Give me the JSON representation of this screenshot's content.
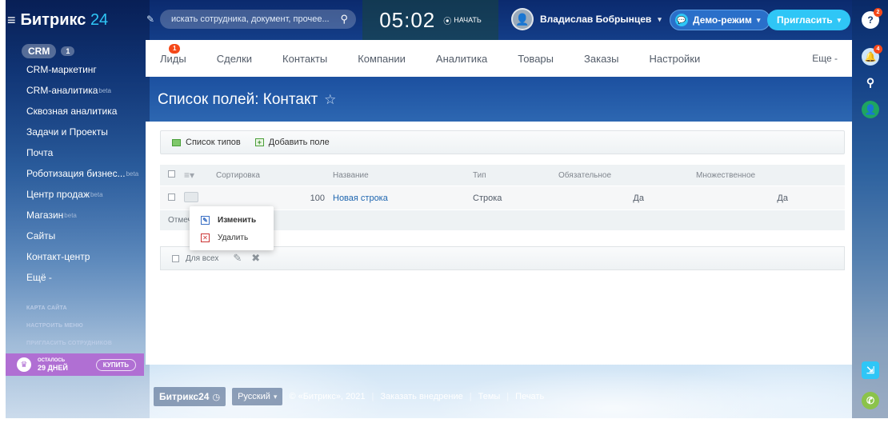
{
  "header": {
    "logo_main": "Битрикс",
    "logo_accent": "24",
    "search_placeholder": "искать сотрудника, документ, прочее...",
    "clock": "05:02",
    "start_label": "НАЧАТЬ",
    "user_name": "Владислав Бобрынцев",
    "demo_label": "Демо-режим",
    "invite_label": "Пригласить"
  },
  "rail": {
    "help_badge": "2",
    "notify_badge": "4"
  },
  "sidebar": {
    "crm_label": "CRM",
    "crm_count": "1",
    "items": [
      {
        "label": "CRM-маркетинг",
        "sup": ""
      },
      {
        "label": "CRM-аналитика",
        "sup": "beta"
      },
      {
        "label": "Сквозная аналитика",
        "sup": ""
      },
      {
        "label": "Задачи и Проекты",
        "sup": ""
      },
      {
        "label": "Почта",
        "sup": ""
      },
      {
        "label": "Роботизация бизнес...",
        "sup": "beta"
      },
      {
        "label": "Центр продаж",
        "sup": "beta"
      },
      {
        "label": "Магазин",
        "sup": "beta"
      },
      {
        "label": "Сайты",
        "sup": ""
      },
      {
        "label": "Контакт-центр",
        "sup": ""
      },
      {
        "label": "Ещё -",
        "sup": ""
      }
    ],
    "links": [
      "КАРТА САЙТА",
      "НАСТРОИТЬ МЕНЮ",
      "ПРИГЛАСИТЬ СОТРУДНИКОВ"
    ],
    "trial_small": "ОСТАЛОСЬ",
    "trial_days": "29 ДНЕЙ",
    "buy_label": "КУПИТЬ"
  },
  "tabs": {
    "items": [
      "Лиды",
      "Сделки",
      "Контакты",
      "Компании",
      "Аналитика",
      "Товары",
      "Заказы",
      "Настройки"
    ],
    "leads_badge": "1",
    "more_label": "Еще -"
  },
  "page": {
    "title": "Список полей: Контакт"
  },
  "toolbar": {
    "types_label": "Список типов",
    "add_label": "Добавить поле"
  },
  "grid": {
    "columns": [
      "Сортировка",
      "Название",
      "Тип",
      "Обязательное",
      "Множественное"
    ],
    "rows": [
      {
        "sort": "100",
        "name": "Новая строка",
        "type": "Строка",
        "required": "Да",
        "multiple": "Да"
      }
    ],
    "footer_text": "Отмечено: 0 / 1"
  },
  "actionbar": {
    "for_all_label": "Для всех"
  },
  "popup": {
    "edit_label": "Изменить",
    "delete_label": "Удалить"
  },
  "footer": {
    "brand": "Битрикс24",
    "language": "Русский",
    "copyright": "© «Битрикс», 2021",
    "order_label": "Заказать внедрение",
    "themes_label": "Темы",
    "print_label": "Печать"
  }
}
